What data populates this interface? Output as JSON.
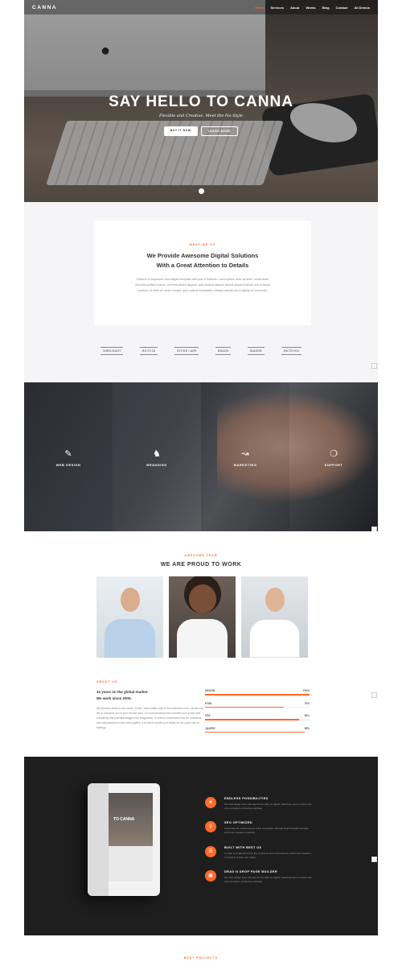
{
  "nav": {
    "logo": "CANNA",
    "items": [
      "Home",
      "Services",
      "About",
      "Works",
      "Blog",
      "Contact",
      "All Demos"
    ],
    "active_index": 0
  },
  "hero": {
    "title": "SAY HELLO TO CANNA",
    "subtitle": "Flexible and Creative. Meet the Nu-Style",
    "button_primary": "BUY IT NOW",
    "button_secondary": "LEARN MORE"
  },
  "what_we_do": {
    "eyebrow": "WHAT WE DO",
    "heading_line1": "We Provide Awesome Digital Solutions",
    "heading_line2": "With a Great Attention to Details",
    "body": "Canna is a responsive and elegant template with tons of features. Lorem ipsum dolor sit amet, consectetur. Sed felis porttitor mauris, lorem sit labore aliquam, quis nostrud ullamco laboris aliqua ut labore sed et aliqua nostrum. Ut enim ad minim veniam, quis nostrud exercitation ullamco laboris nisi ut aliquip ex commodo.",
    "clients": [
      "MERCHANT",
      "BICYCLE",
      "STONE CAFE",
      "BRAND",
      "BAKERY",
      "FACTIONS"
    ]
  },
  "services": {
    "items": [
      {
        "label": "WEB DESIGN",
        "icon": "pencil-ruler-icon"
      },
      {
        "label": "BRANDING",
        "icon": "chess-knight-icon"
      },
      {
        "label": "MARKETING",
        "icon": "line-graph-icon"
      },
      {
        "label": "SUPPORT",
        "icon": "lifebuoy-icon"
      }
    ]
  },
  "team": {
    "eyebrow": "AWESOME TEAM",
    "heading": "WE ARE PROUD TO WORK"
  },
  "about": {
    "eyebrow": "ABOUT US",
    "heading_line1": "10 years on the global market.",
    "heading_line2": "We work since 2005.",
    "body": "We possess within us two minds. So far I have written only of the conscious mind. I would now like to introduce you to your second mind. Our subconscious mind contains such power and complexity that it literally staggers the imagination. In order to understand how the conscious and subconscious minds work together, it is best to create your reality, let the upper use on strategy.",
    "skills": [
      {
        "name": "DESIGN",
        "value": "100%",
        "fraction": 1.0
      },
      {
        "name": "HTML",
        "value": "75%",
        "fraction": 0.75
      },
      {
        "name": "CSS",
        "value": "90%",
        "fraction": 0.9
      },
      {
        "name": "JQUERY",
        "value": "95%",
        "fraction": 0.95
      }
    ]
  },
  "features": {
    "tablet_text": "TO CANNA",
    "items": [
      {
        "title": "ENDLESS POSSIBILITIES",
        "icon": "trophy-icon",
        "desc": "Our web design team will spend time with our digital marketing team to ensure the core principles of effective websites."
      },
      {
        "title": "SEO OPTIMIZED",
        "icon": "magnifier-icon",
        "desc": "And finally the subconscious is the mechanism through which thought impulses which are repeated regularly."
      },
      {
        "title": "BUILT WITH BEST UX",
        "icon": "layers-icon",
        "desc": "In order to understand how the conscious and subconscious minds work together, it is best to create your reality."
      },
      {
        "title": "DRAG N DROP PAGE BUILDER",
        "icon": "screen-icon",
        "desc": "Our web design team will spend time with our digital marketing team to ensure the core principles of effective websites."
      }
    ]
  },
  "footer_eyebrow": "BEST PROJECTS",
  "colors": {
    "accent": "#ff6a2b",
    "dark": "#1e1e1e",
    "light_bg": "#f5f5f7"
  }
}
